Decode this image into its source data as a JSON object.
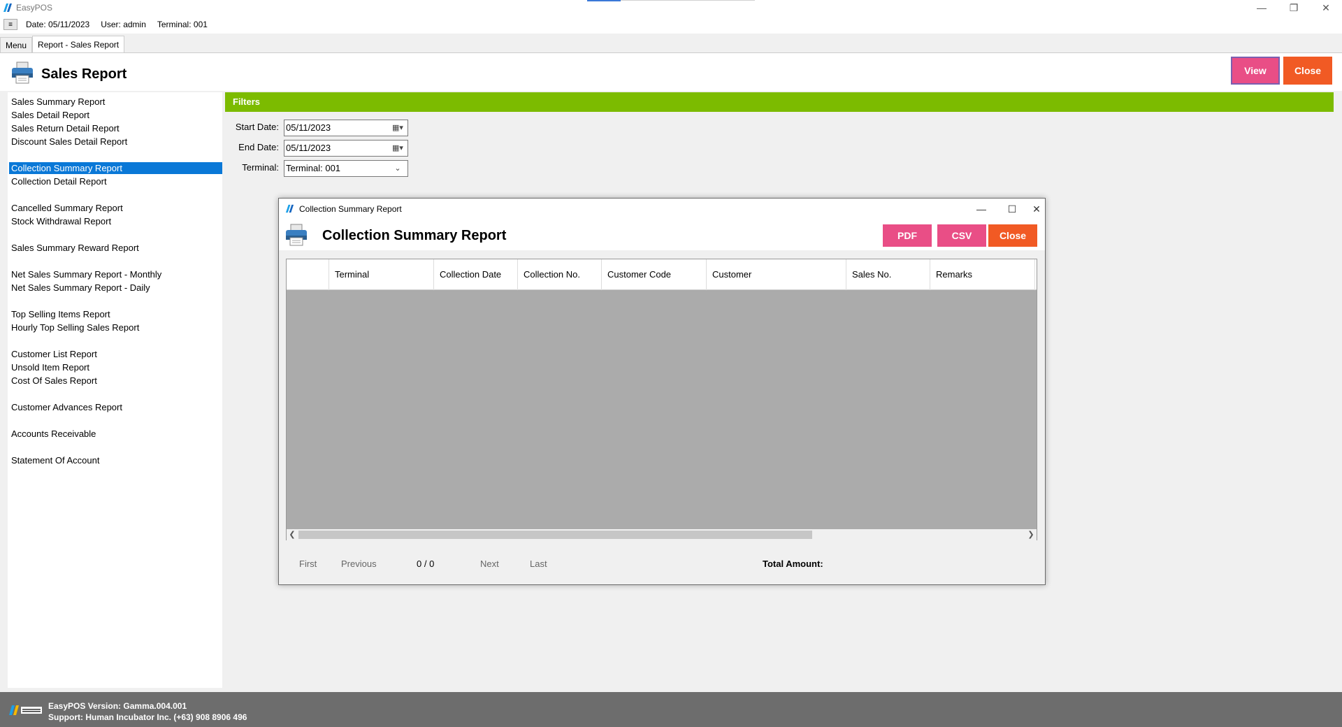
{
  "app": {
    "title": "EasyPOS"
  },
  "infobar": {
    "menu_toggle": "≡",
    "date": "Date: 05/11/2023",
    "user": "User: admin",
    "terminal": "Terminal: 001"
  },
  "tabs": [
    {
      "label": "Menu"
    },
    {
      "label": "Report - Sales Report"
    }
  ],
  "page": {
    "title": "Sales Report",
    "view_label": "View",
    "close_label": "Close"
  },
  "sidebar": {
    "items": [
      "Sales Summary Report",
      "Sales Detail Report",
      "Sales Return Detail Report",
      "Discount Sales Detail Report",
      "Collection Summary Report",
      "Collection Detail Report",
      "Cancelled Summary Report",
      "Stock Withdrawal Report",
      "Sales Summary Reward Report",
      "Net Sales Summary Report - Monthly",
      "Net Sales Summary Report - Daily",
      "Top Selling Items Report",
      "Hourly Top Selling Sales Report",
      "Customer List Report",
      "Unsold Item Report",
      "Cost Of Sales Report",
      "Customer Advances Report",
      "Accounts Receivable",
      "Statement Of Account"
    ],
    "selected": "Collection Summary Report"
  },
  "filters": {
    "title": "Filters",
    "start_date_label": "Start Date:",
    "start_date_value": "05/11/2023",
    "end_date_label": "End Date:",
    "end_date_value": "05/11/2023",
    "terminal_label": "Terminal:",
    "terminal_value": "Terminal: 001"
  },
  "dialog": {
    "window_title": "Collection Summary Report",
    "heading": "Collection Summary Report",
    "pdf_label": "PDF",
    "csv_label": "CSV",
    "close_label": "Close",
    "columns": [
      "",
      "Terminal",
      "Collection Date",
      "Collection No.",
      "Customer Code",
      "Customer",
      "Sales No.",
      "Remarks"
    ],
    "pager": {
      "first": "First",
      "previous": "Previous",
      "page_count": "0 / 0",
      "next": "Next",
      "last": "Last",
      "total_label": "Total Amount:"
    }
  },
  "footer": {
    "version": "EasyPOS Version: Gamma.004.001",
    "support": "Support: Human Incubator Inc. (+63) 908 8906 496"
  },
  "colors": {
    "accent_green": "#7cbb00",
    "pink": "#e94e86",
    "orange": "#f15a24",
    "selected_blue": "#0a78d7"
  }
}
